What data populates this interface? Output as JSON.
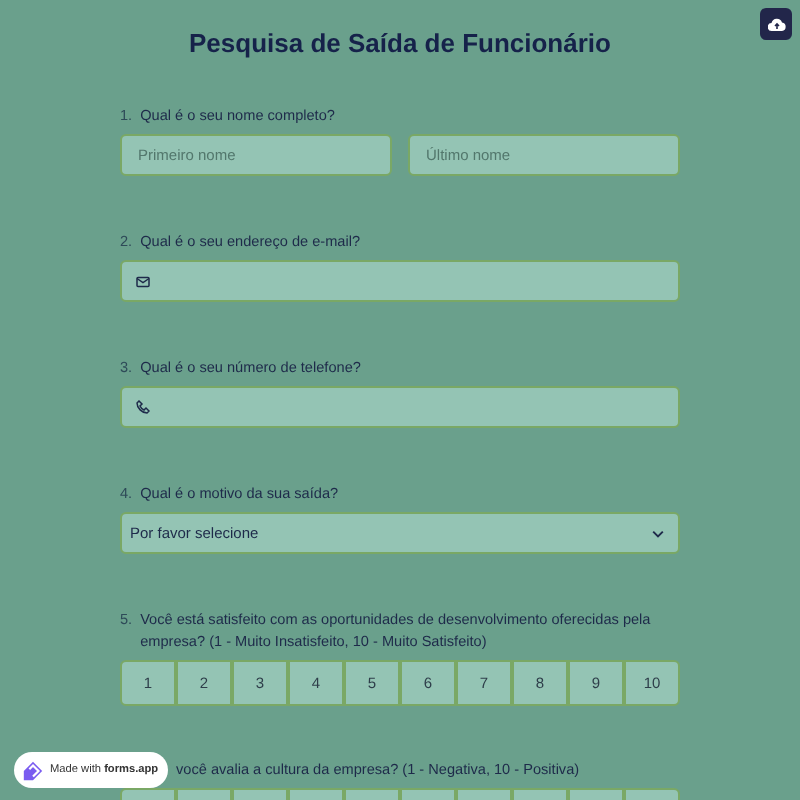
{
  "title": "Pesquisa de Saída de Funcionário",
  "questions": [
    {
      "kind": "name",
      "number": "1.",
      "label": "Qual é o seu nome completo?",
      "fields": [
        {
          "placeholder": "Primeiro nome"
        },
        {
          "placeholder": "Último nome"
        }
      ]
    },
    {
      "kind": "email",
      "number": "2.",
      "label": "Qual é o seu endereço de e-mail?"
    },
    {
      "kind": "phone",
      "number": "3.",
      "label": "Qual é o seu número de telefone?"
    },
    {
      "kind": "select",
      "number": "4.",
      "label": "Qual é o motivo da sua saída?",
      "value": "Por favor selecione"
    },
    {
      "kind": "scale",
      "number": "5.",
      "label": "Você está satisfeito com as oportunidades de desenvolvimento oferecidas pela empresa? (1 - Muito Insatisfeito, 10 - Muito Satisfeito)",
      "options": [
        "1",
        "2",
        "3",
        "4",
        "5",
        "6",
        "7",
        "8",
        "9",
        "10"
      ]
    },
    {
      "kind": "scale_partial",
      "label": "você avalia a cultura da empresa? (1 - Negativa, 10 - Positiva)"
    }
  ],
  "badge": {
    "prefix": "Made with",
    "brand": "forms.app"
  }
}
